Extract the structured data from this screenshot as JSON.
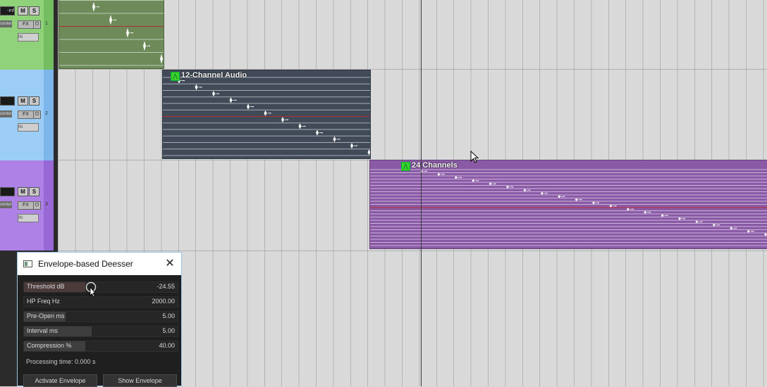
{
  "tracks": [
    {
      "number": "1",
      "volume": "-inf",
      "mute": "M",
      "solo": "S",
      "fx": "FX",
      "power": "⏻",
      "pan": "center",
      "input": "IN",
      "color": "#8fd27a",
      "strip": "#74bd61"
    },
    {
      "number": "2",
      "volume": "",
      "mute": "M",
      "solo": "S",
      "fx": "FX",
      "power": "⏻",
      "pan": "center",
      "input": "IN",
      "color": "#9ccdf6",
      "strip": "#7cb6ea"
    },
    {
      "number": "3",
      "volume": "",
      "mute": "M",
      "solo": "S",
      "fx": "FX",
      "power": "⏻",
      "pan": "center",
      "input": "IN",
      "color": "#ae81e6",
      "strip": "#9868d6"
    }
  ],
  "items": [
    {
      "label": "",
      "color": "#6d8a58",
      "channels": 6
    },
    {
      "label": "12-Channel Audio",
      "color": "#414b58",
      "channels": 12
    },
    {
      "label": "24 Channels",
      "color": "#8a5aa6",
      "channels": 24
    }
  ],
  "fx_window": {
    "title": "Envelope-based Deesser",
    "close_icon": "close-icon",
    "params": [
      {
        "label": "Threshold dB",
        "value": "-24.55",
        "fill": 0.4
      },
      {
        "label": "HP Freq Hz",
        "value": "2000.00",
        "fill": 0.0
      },
      {
        "label": "Pre-Open ms",
        "value": "5.00",
        "fill": 0.27
      },
      {
        "label": "Interval ms",
        "value": "5.00",
        "fill": 0.44
      },
      {
        "label": "Compression %",
        "value": "40.00",
        "fill": 0.4
      }
    ],
    "processing_time": "Processing time: 0.000 s",
    "activate_envelope": "Activate Envelope",
    "show_envelope": "Show Envelope"
  }
}
